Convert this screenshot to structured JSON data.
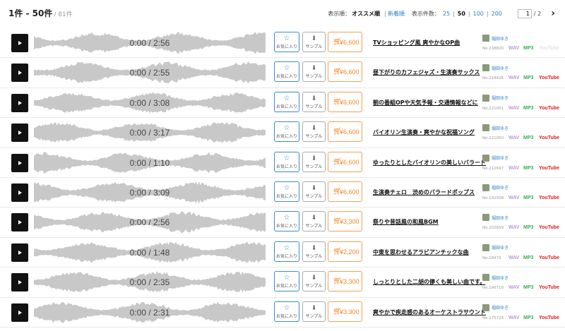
{
  "header": {
    "range": "1件 - 50件",
    "total": "/ 81件",
    "sort_label": "表示順：",
    "sort_active": "オススメ順",
    "sort_sep": "|",
    "sort_alt": "新着順",
    "perpage_label": "表示件数：",
    "perpage_options": [
      "25",
      "50",
      "100",
      "200"
    ],
    "perpage_active": "50",
    "page_current": "1",
    "page_total": "/ 2",
    "next_icon": "›"
  },
  "labels": {
    "favorite": "お気に入り",
    "sample": "サンプル",
    "wav": "WAV",
    "mp3": "MP3",
    "youtube": "YouTube"
  },
  "colors": {
    "favorite_border": "#3a8bd0",
    "buy_accent": "#f08a2a",
    "wav": "#b79bd8",
    "mp3": "#2fb34a",
    "youtube": "#d92020",
    "waveform": "#c8c8c8"
  },
  "tracks": [
    {
      "time": "0:00 / 2:56",
      "price": "¥6,600",
      "title": "TVショッピング風 爽やかなOP曲",
      "author": "堀田ゆき",
      "no": "No.238820",
      "youtube": false
    },
    {
      "time": "0:00 / 2:55",
      "price": "¥6,600",
      "title": "昼下がりのカフェジャズ・生演奏サックス",
      "author": "堀田ゆき",
      "no": "No.224426",
      "youtube": true
    },
    {
      "time": "0:00 / 3:08",
      "price": "¥6,600",
      "title": "朝の番組OPや天気予報・交通情報などに",
      "author": "堀田ゆき",
      "no": "No.221051",
      "youtube": true
    },
    {
      "time": "0:00 / 3:17",
      "price": "¥6,600",
      "title": "バイオリン生演奏・爽やかな祝福ソング",
      "author": "堀田ゆき",
      "no": "No.221050",
      "youtube": true
    },
    {
      "time": "0:00 / 1:10",
      "price": "¥6,600",
      "title": "ゆったりとしたバイオリンの美しいバラード",
      "author": "堀田ゆき",
      "no": "No.212697",
      "youtube": true
    },
    {
      "time": "0:00 / 3:09",
      "price": "¥6,600",
      "title": "生演奏チェロ　渋めのバラードポップス",
      "author": "堀田ゆき",
      "no": "No.192508",
      "youtube": true
    },
    {
      "time": "0:00 / 2:56",
      "price": "¥3,300",
      "title": "祭りや昔話風の和風BGM",
      "author": "堀田ゆき",
      "no": "No.102659",
      "youtube": true
    },
    {
      "time": "0:00 / 1:48",
      "price": "¥2,200",
      "title": "中東を思わせるアラビアンチックな曲",
      "author": "堀田ゆき",
      "no": "No.18473",
      "youtube": true
    },
    {
      "time": "0:00 / 2:35",
      "price": "¥3,300",
      "title": "しっとりとした二胡の儚くも美しい曲です。",
      "author": "堀田ゆき",
      "no": "No.199710",
      "youtube": true
    },
    {
      "time": "0:00 / 2:31",
      "price": "¥3,300",
      "title": "爽やかで疾走感のあるオーケストラサウンド",
      "author": "堀田ゆき",
      "no": "No.175724",
      "youtube": true
    }
  ]
}
